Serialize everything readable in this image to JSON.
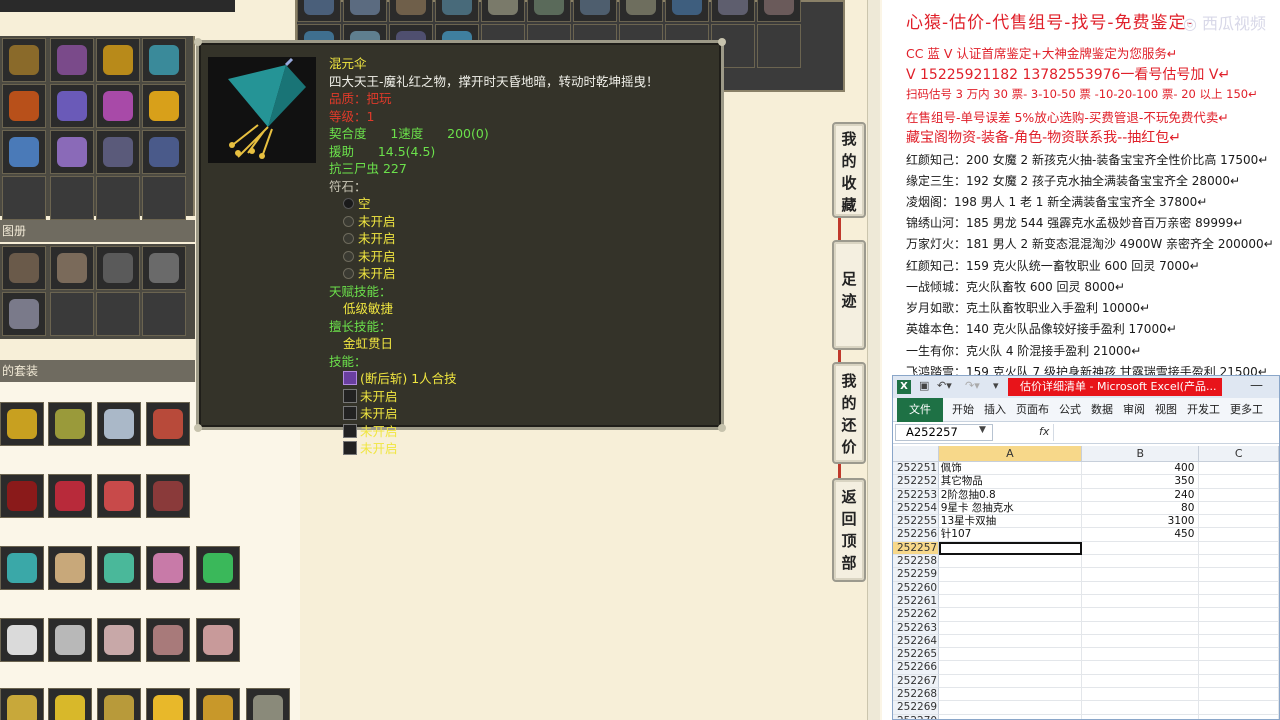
{
  "game": {
    "section_album": "图册",
    "section_suit": "的套装"
  },
  "tooltip": {
    "item_name": "混元伞",
    "description": "四大天王-魔礼红之物，撑开时天昏地暗，转动时乾坤摇曳！",
    "quality": "品质：把玩",
    "level": "等级：1",
    "compat": "契合度      1速度      200(0)",
    "assist": "援助      14.5(4.5)",
    "resist": "抗三尸虫 227",
    "rune_title": "符石：",
    "runes": [
      "空",
      "未开启",
      "未开启",
      "未开启",
      "未开启"
    ],
    "talent_title": "天赋技能：",
    "talent_value": "低级敏捷",
    "specialty_title": "擅长技能：",
    "specialty_value": "金虹贯日",
    "skill_title": "技能：",
    "skills": [
      "(断后斩) 1人合技",
      "未开启",
      "未开启",
      "未开启",
      "未开启"
    ]
  },
  "side_buttons": [
    {
      "label": [
        "我",
        "的",
        "收",
        "藏"
      ]
    },
    {
      "label": [
        "足",
        "迹"
      ]
    },
    {
      "label": [
        "我",
        "的",
        "还",
        "价"
      ]
    },
    {
      "label": [
        "返",
        "回",
        "顶",
        "部"
      ]
    }
  ],
  "info": {
    "title": "心猿-估价-代售组号-找号-免费鉴定-",
    "watermark": "◎ 西瓜视频",
    "lines_red": [
      "CC 蓝 V 认证首席鉴定+大神金牌鉴定为您服务↵",
      "V 15225921182      13782553976一看号估号加 V↵",
      "扫码估号 3 万内 30 票- 3-10-50 票   -10-20-100 票- 20 以上 150↵",
      "在售组号-单号误差 5%放心选购-买费管退-不玩免费代卖↵",
      "藏宝阁物资-装备-角色-物资联系我--抽红包↵"
    ],
    "lines_black": [
      "红颜知己：200 女魔 2 新孩克火抽-装备宝宝齐全性价比高 17500↵",
      "缘定三生：192 女魔 2 孩子克水抽全满装备宝宝齐全 28000↵",
      "凌烟阁：198 男人 1 老 1 新全满装备宝宝齐全 37800↵",
      "锦绣山河：185 男龙 544 强霹克水孟极妙音百万亲密 89999↵",
      "万家灯火：181 男人 2 新变态混混淘沙 4900W 亲密齐全 200000↵",
      "红颜知己：159 克火队统一畜牧职业 600 回灵 7000↵",
      "一战倾城：克火队畜牧 600 回灵 8000↵",
      "岁月如歌：克土队畜牧职业入手盈利 10000↵",
      "英雄本色：140 克火队品像较好接手盈利 17000↵",
      "一生有你：克火队 4 阶混接手盈利 21000↵",
      "飞鸿踏雪：159 克火队 7 级护身新神孩 甘露瑞雪接手盈利 21500↵"
    ]
  },
  "excel": {
    "logo": "X",
    "title": "估价详细清单 - Microsoft Excel(产品...",
    "tabs": [
      "文件",
      "开始",
      "插入",
      "页面布",
      "公式",
      "数据",
      "审阅",
      "视图",
      "开发工",
      "更多工"
    ],
    "name_box": "A252257",
    "fx": "fx",
    "columns": [
      "A",
      "B",
      "C"
    ],
    "rows": [
      {
        "n": "252251",
        "a": "佩饰",
        "b": "400"
      },
      {
        "n": "252252",
        "a": "其它物品",
        "b": "350"
      },
      {
        "n": "252253",
        "a": "2阶忽抽0.8",
        "b": "240"
      },
      {
        "n": "252254",
        "a": "9星卡 忽抽克水",
        "b": "80"
      },
      {
        "n": "252255",
        "a": "13星卡双抽",
        "b": "3100"
      },
      {
        "n": "252256",
        "a": "针107",
        "b": "450"
      },
      {
        "n": "252257",
        "a": "",
        "b": ""
      },
      {
        "n": "252258",
        "a": "",
        "b": ""
      },
      {
        "n": "252259",
        "a": "",
        "b": ""
      },
      {
        "n": "252260",
        "a": "",
        "b": ""
      },
      {
        "n": "252261",
        "a": "",
        "b": ""
      },
      {
        "n": "252262",
        "a": "",
        "b": ""
      },
      {
        "n": "252263",
        "a": "",
        "b": ""
      },
      {
        "n": "252264",
        "a": "",
        "b": ""
      },
      {
        "n": "252265",
        "a": "",
        "b": ""
      },
      {
        "n": "252266",
        "a": "",
        "b": ""
      },
      {
        "n": "252267",
        "a": "",
        "b": ""
      },
      {
        "n": "252268",
        "a": "",
        "b": ""
      },
      {
        "n": "252269",
        "a": "",
        "b": ""
      },
      {
        "n": "252270",
        "a": "",
        "b": ""
      }
    ]
  }
}
